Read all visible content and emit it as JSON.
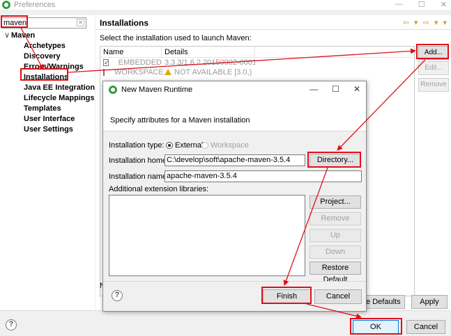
{
  "window": {
    "title": "Preferences",
    "controls": [
      "—",
      "☐",
      "✕"
    ]
  },
  "filter": {
    "value": "maven"
  },
  "tree": {
    "root": "Maven",
    "children": [
      "Archetypes",
      "Discovery",
      "Errors/Warnings",
      "Installations",
      "Java EE Integration",
      "Lifecycle Mappings",
      "Templates",
      "User Interface",
      "User Settings"
    ]
  },
  "page": {
    "title": "Installations",
    "description": "Select the installation used to launch Maven:",
    "nav_arrows": "⇦ ▾ ⇨ ▾ ▾"
  },
  "table": {
    "columns": [
      "Name",
      "Details"
    ],
    "rows": [
      {
        "checked": true,
        "name": "EMBEDDED",
        "details": "3.3.3/1.6.2.20150902-0001",
        "warning": false
      },
      {
        "checked": false,
        "name": "WORKSPACE",
        "details": "NOT AVAILABLE [3.0,)",
        "warning": true
      }
    ]
  },
  "side_buttons": {
    "add": "Add...",
    "edit": "Edit...",
    "remove": "Remove"
  },
  "bottom_buttons": {
    "restore": "re Defaults",
    "apply": "Apply",
    "left_cut": "N"
  },
  "footer": {
    "help": "?",
    "ok": "OK",
    "cancel": "Cancel"
  },
  "dialog": {
    "title": "New Maven Runtime",
    "controls": [
      "—",
      "☐",
      "✕"
    ],
    "message": "Specify attributes for a Maven installation",
    "installation_type_label": "Installation type:",
    "type_external": "External",
    "type_workspace": "Workspace",
    "installation_home_label": "Installation home:",
    "installation_home_value": "C:\\develop\\soft\\apache-maven-3.5.4",
    "directory_button": "Directory...",
    "installation_name_label": "Installation name:",
    "installation_name_value": "apache-maven-3.5.4",
    "ext_libs_label": "Additional extension libraries:",
    "buttons": {
      "project": "Project...",
      "remove": "Remove",
      "up": "Up",
      "down": "Down",
      "restore_default": "Restore Default"
    },
    "help": "?",
    "finish": "Finish",
    "cancel": "Cancel"
  },
  "colors": {
    "highlight": "#e0101a",
    "accent_icon": "#2f9e44",
    "warning": "#e0a800"
  }
}
